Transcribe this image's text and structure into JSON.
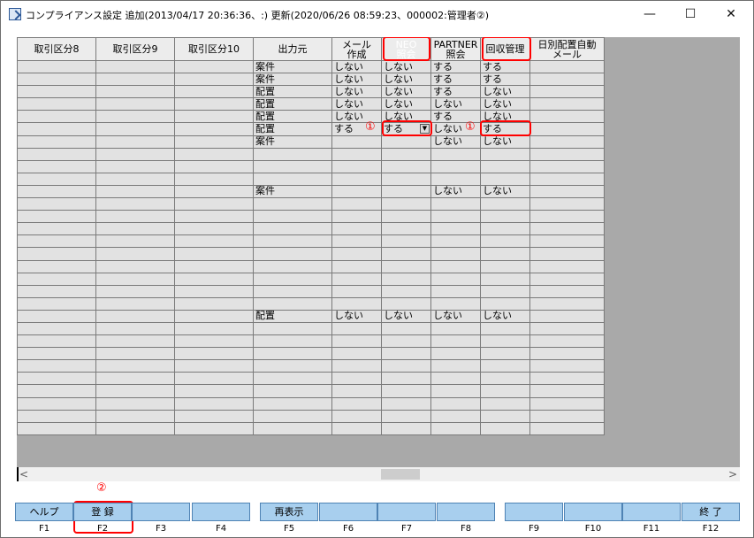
{
  "window": {
    "title": "コンプライアンス設定 追加(2013/04/17 20:36:36、:) 更新(2020/06/26 08:59:23、000002:管理者②)",
    "minimize_glyph": "—",
    "maximize_glyph": "☐",
    "close_glyph": "✕"
  },
  "grid": {
    "headers": [
      "取引区分8",
      "取引区分9",
      "取引区分10",
      "出力元",
      "メール\n作成",
      "NEO\n照会",
      "PARTNER\n照会",
      "回収管理",
      "日別配置自動\nメール"
    ],
    "rows": [
      {
        "src": "案件",
        "mail": "しない",
        "neo": "しない",
        "partner": "する",
        "kaishu": "する",
        "style": "w"
      },
      {
        "src": "案件",
        "mail": "しない",
        "neo": "しない",
        "partner": "する",
        "kaishu": "する",
        "style": "y"
      },
      {
        "src": "配置",
        "mail": "しない",
        "neo": "しない",
        "partner": "する",
        "kaishu": "しない",
        "style": "w"
      },
      {
        "src": "配置",
        "mail": "しない",
        "neo": "しない",
        "partner": "しない",
        "kaishu": "しない",
        "style": "y"
      },
      {
        "src": "配置",
        "mail": "しない",
        "neo": "しない",
        "partner": "する",
        "kaishu": "しない",
        "style": "w"
      },
      {
        "src": "配置",
        "mail": "する",
        "neo": "する",
        "partner": "しない",
        "kaishu": "する",
        "style": "y"
      },
      {
        "src": "案件",
        "mail": "",
        "neo": "",
        "partner": "しない",
        "kaishu": "しない",
        "style": "w"
      }
    ],
    "row_anken2": {
      "src": "案件",
      "partner": "しない",
      "kaishu": "しない"
    },
    "row_haichi2": {
      "src": "配置",
      "mail": "しない",
      "neo": "しない",
      "partner": "しない",
      "kaishu": "しない"
    },
    "dropdown_glyph": "▼"
  },
  "annotations": {
    "circle1": "①",
    "circle2": "②"
  },
  "scrollbar": {
    "left_glyph": "<",
    "right_glyph": ">"
  },
  "function_keys": [
    {
      "key": "F1",
      "label": "ヘルプ"
    },
    {
      "key": "F2",
      "label": "登 録"
    },
    {
      "key": "F3",
      "label": ""
    },
    {
      "key": "F4",
      "label": ""
    },
    {
      "key": "F5",
      "label": "再表示"
    },
    {
      "key": "F6",
      "label": ""
    },
    {
      "key": "F7",
      "label": ""
    },
    {
      "key": "F8",
      "label": ""
    },
    {
      "key": "F9",
      "label": ""
    },
    {
      "key": "F10",
      "label": ""
    },
    {
      "key": "F11",
      "label": ""
    },
    {
      "key": "F12",
      "label": "終 了"
    }
  ],
  "colors": {
    "neo_header": "#ff8c00",
    "highlight_row": "#ffffc6",
    "fkey": "#a8cfee",
    "annotation": "#ff0000"
  }
}
